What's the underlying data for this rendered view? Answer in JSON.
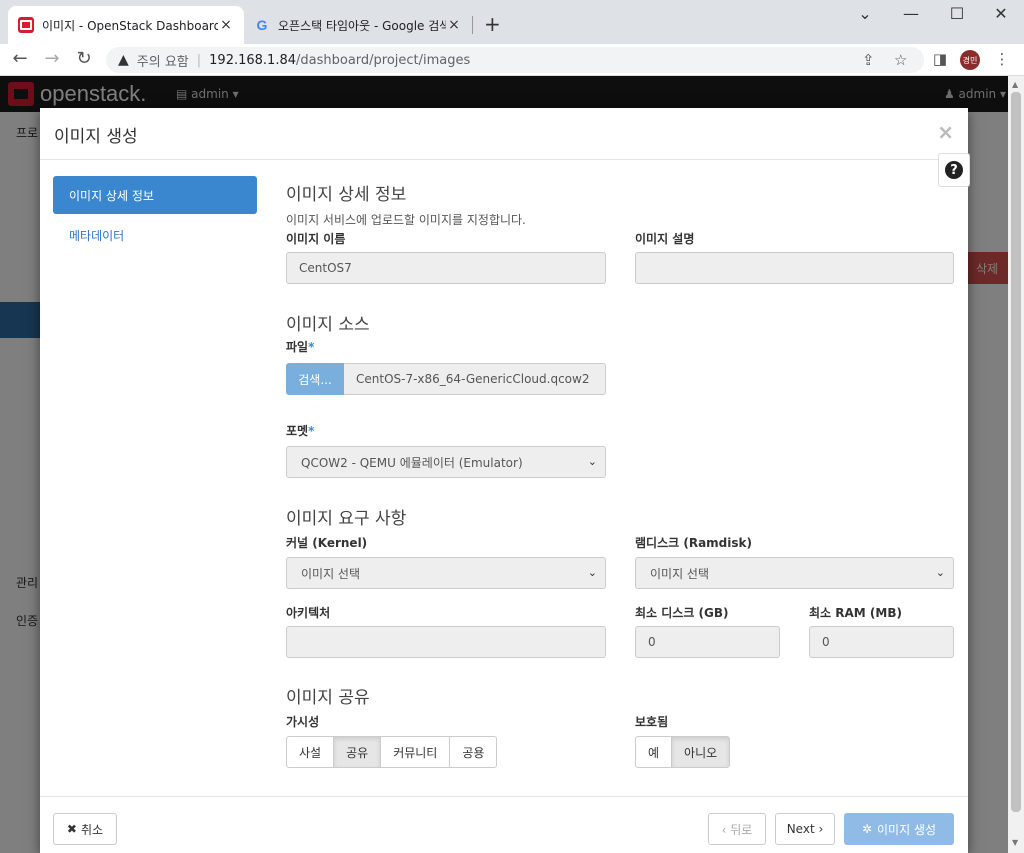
{
  "browser": {
    "tabs": [
      {
        "title": "이미지 - OpenStack Dashboard",
        "close": "×"
      },
      {
        "title": "오픈스택 타임아웃 - Google 검색",
        "close": "×"
      }
    ],
    "new_tab": "+",
    "window_controls": {
      "minimize": "—",
      "maximize": "☐",
      "close": "✕",
      "tab_search": "⌄"
    },
    "address": {
      "warning_label": "주의 요함",
      "url_host": "192.168.1.84",
      "url_path": "/dashboard/project/images"
    },
    "profile_initials": "경민"
  },
  "openstack": {
    "logo_text": "openstack.",
    "project_label": "admin",
    "user_label": "admin",
    "bg_texts": {
      "left_top": "프로",
      "manage": "관리",
      "auth": "인증",
      "delete": "삭제"
    }
  },
  "modal": {
    "title": "이미지 생성",
    "close": "×",
    "help": "?",
    "nav": [
      {
        "label": "이미지 상세 정보"
      },
      {
        "label": "메타데이터"
      }
    ],
    "details": {
      "title": "이미지 상세 정보",
      "description": "이미지 서비스에 업로드할 이미지를 지정합니다.",
      "name_label": "이미지 이름",
      "name_value": "CentOS7",
      "desc_label": "이미지 설명",
      "desc_value": ""
    },
    "source": {
      "title": "이미지 소스",
      "file_label": "파일",
      "browse_label": "검색...",
      "file_name": "CentOS-7-x86_64-GenericCloud.qcow2",
      "format_label": "포멧",
      "format_value": "QCOW2 - QEMU 에뮬레이터 (Emulator)"
    },
    "requirements": {
      "title": "이미지 요구 사항",
      "kernel_label": "커널 (Kernel)",
      "kernel_value": "이미지 선택",
      "ramdisk_label": "램디스크 (Ramdisk)",
      "ramdisk_value": "이미지 선택",
      "arch_label": "아키텍처",
      "arch_value": "",
      "min_disk_label": "최소 디스크 (GB)",
      "min_disk_value": "0",
      "min_ram_label": "최소 RAM (MB)",
      "min_ram_value": "0"
    },
    "sharing": {
      "title": "이미지 공유",
      "visibility_label": "가시성",
      "visibility_options": [
        "사설",
        "공유",
        "커뮤니티",
        "공용"
      ],
      "visibility_selected": "공유",
      "protected_label": "보호됨",
      "protected_options": [
        "예",
        "아니오"
      ],
      "protected_selected": "아니오"
    },
    "footer": {
      "cancel": "취소",
      "back": "‹ 뒤로",
      "next": "Next ›",
      "create": "이미지 생성"
    }
  },
  "colors": {
    "accent": "#3a87cf",
    "brand": "#da1a32",
    "primary_disabled": "#8fbbe6"
  }
}
